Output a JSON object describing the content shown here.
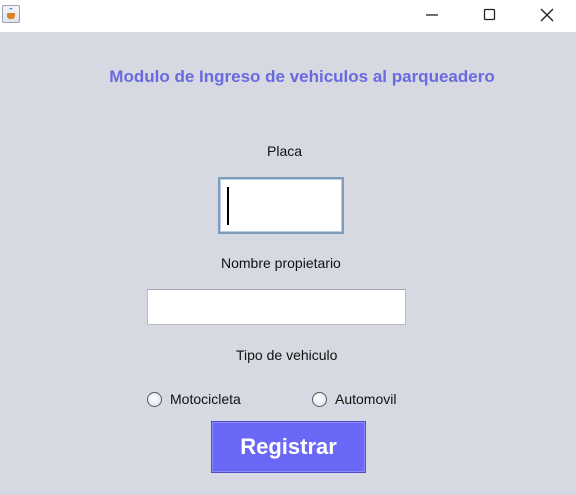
{
  "window": {
    "title": "",
    "controls": [
      "minimize-icon",
      "maximize-icon",
      "close-icon"
    ]
  },
  "form": {
    "heading": "Modulo de Ingreso de vehiculos al parqueadero",
    "placa_label": "Placa",
    "placa_value": "",
    "nombre_label": "Nombre propietario",
    "nombre_value": "",
    "tipo_label": "Tipo de vehiculo",
    "options": [
      "Motocicleta",
      "Automovil"
    ],
    "selected_option": null,
    "submit_label": "Registrar"
  },
  "colors": {
    "heading": "#6a6ae0",
    "button": "#6b68f7",
    "background": "#d6d9e1"
  }
}
